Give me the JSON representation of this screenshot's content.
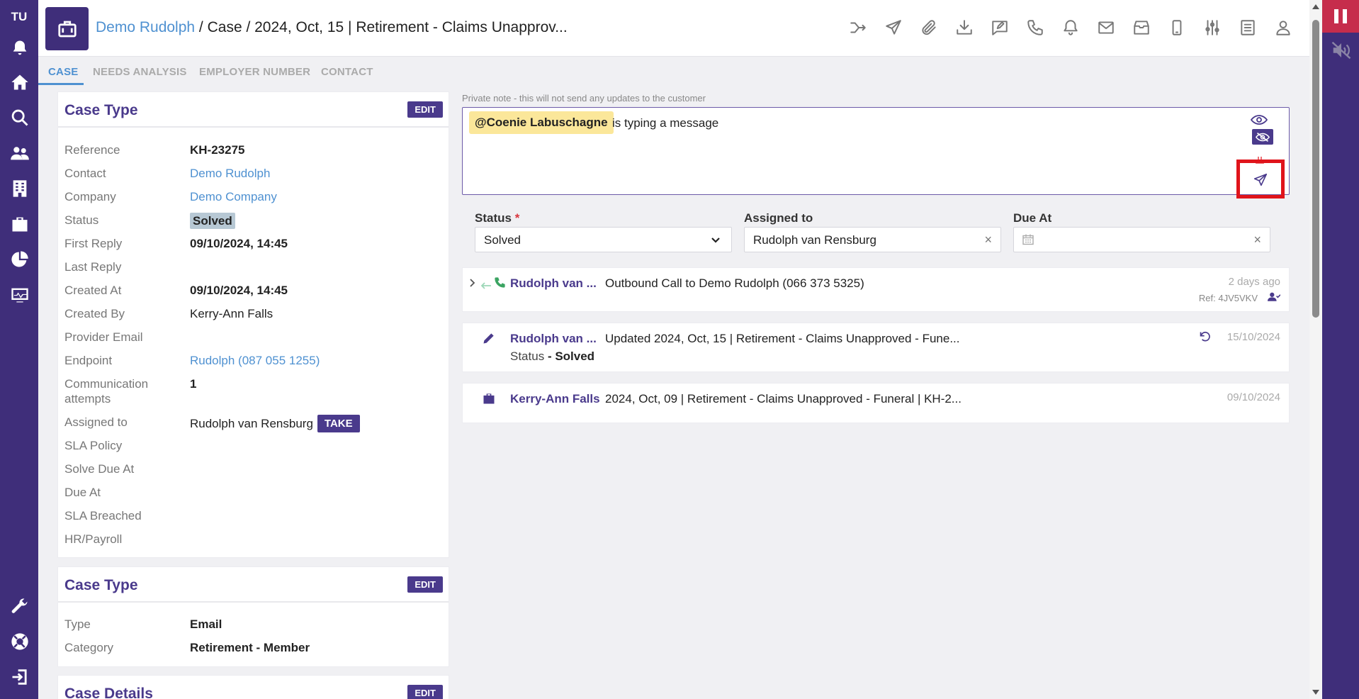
{
  "sidebar": {
    "initials": "TU"
  },
  "header": {
    "breadcrumb_contact": "Demo Rudolph",
    "breadcrumb_rest": " / Case / 2024, Oct, 15 | Retirement - Claims Unapprov..."
  },
  "tabs": [
    "CASE",
    "NEEDS ANALYSIS",
    "EMPLOYER NUMBER",
    "CONTACT"
  ],
  "case_card": {
    "title": "Case Type",
    "edit_label": "EDIT",
    "fields": {
      "reference_label": "Reference",
      "reference": "KH-23275",
      "contact_label": "Contact",
      "contact": "Demo Rudolph",
      "company_label": "Company",
      "company": "Demo Company",
      "status_label": "Status",
      "status": "Solved",
      "first_reply_label": "First Reply",
      "first_reply": "09/10/2024, 14:45",
      "last_reply_label": "Last Reply",
      "created_at_label": "Created At",
      "created_at": "09/10/2024, 14:45",
      "created_by_label": "Created By",
      "created_by": "Kerry-Ann Falls",
      "provider_email_label": "Provider Email",
      "endpoint_label": "Endpoint",
      "endpoint": "Rudolph (087 055 1255)",
      "comm_attempts_label": "Communication attempts",
      "comm_attempts": "1",
      "assigned_to_label": "Assigned to",
      "assigned_to": "Rudolph van Rensburg",
      "take_label": "TAKE",
      "sla_policy_label": "SLA Policy",
      "solve_due_label": "Solve Due At",
      "due_at_label": "Due At",
      "sla_breached_label": "SLA Breached",
      "hr_payroll_label": "HR/Payroll"
    }
  },
  "type_card": {
    "title": "Case Type",
    "edit_label": "EDIT",
    "type_label": "Type",
    "type": "Email",
    "category_label": "Category",
    "category": "Retirement - Member"
  },
  "details_card": {
    "title": "Case Details",
    "edit_label": "EDIT"
  },
  "note": {
    "label": "Private note - this will not send any updates to the customer",
    "mention": "@Coenie Labuschagne",
    "typing": "is typing a message"
  },
  "form": {
    "status_label": "Status",
    "required_mark": "*",
    "status_value": "Solved",
    "assigned_label": "Assigned to",
    "assigned_value": "Rudolph van Rensburg",
    "due_label": "Due At",
    "clear": "×"
  },
  "timeline": [
    {
      "who": "Rudolph van ...",
      "msg": "Outbound Call to Demo Rudolph (066 373 5325)",
      "when": "2 days ago",
      "ref": "Ref: 4JV5VKV"
    },
    {
      "who": "Rudolph van ...",
      "msg": "Updated 2024, Oct, 15 | Retirement - Claims Unapproved - Fune...",
      "status_key": "Status",
      "status_val": "- Solved",
      "when": "15/10/2024"
    },
    {
      "who": "Kerry-Ann Falls",
      "msg": "2024, Oct, 09 | Retirement - Claims Unapproved - Funeral | KH-2...",
      "when": "09/10/2024"
    }
  ]
}
